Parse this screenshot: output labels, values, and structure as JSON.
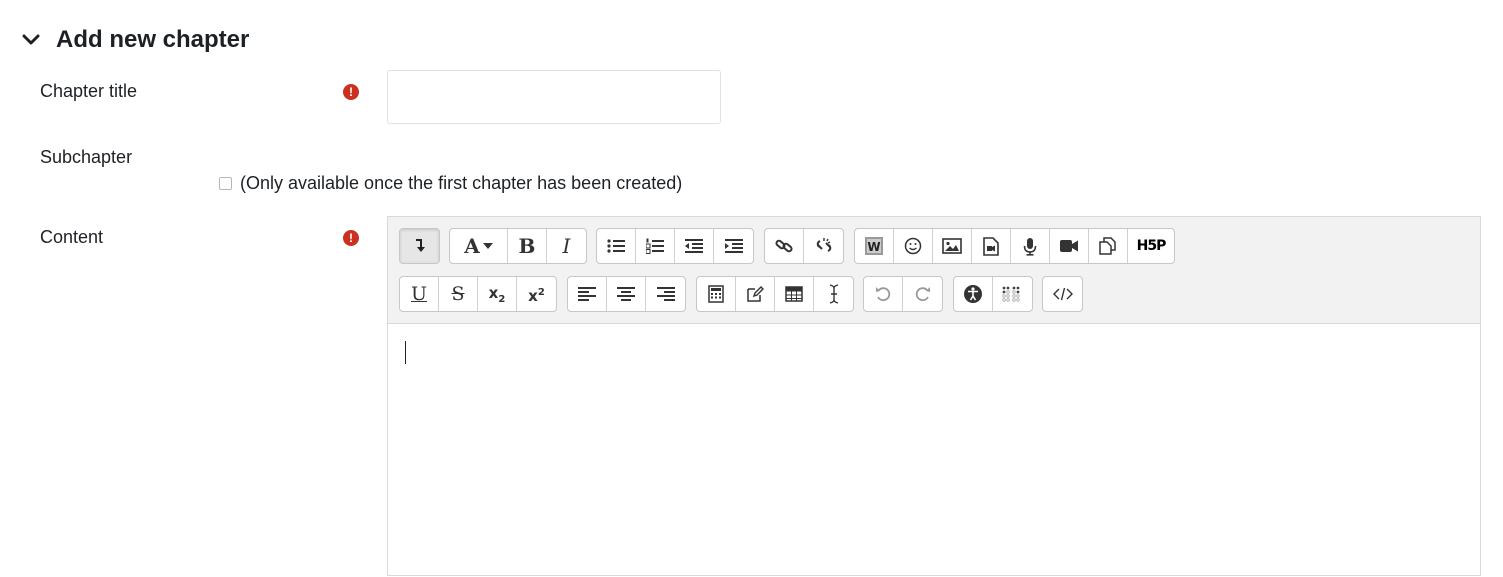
{
  "section": {
    "title": "Add new chapter"
  },
  "fields": {
    "chapter_title": {
      "label": "Chapter title",
      "value": ""
    },
    "subchapter": {
      "label": "Subchapter",
      "note": "(Only available once the first chapter has been created)"
    },
    "content": {
      "label": "Content"
    }
  },
  "colors": {
    "required": "#ca3120",
    "toolbar_bg": "#f2f2f2",
    "border": "#d9d9d9"
  },
  "toolbar": {
    "row1": [
      [
        "collapse-icon"
      ],
      [
        "font-style-icon",
        "bold-icon",
        "italic-icon"
      ],
      [
        "unordered-list-icon",
        "ordered-list-icon",
        "outdent-icon",
        "indent-icon"
      ],
      [
        "link-icon",
        "unlink-icon"
      ],
      [
        "word-paste-icon",
        "emoji-icon",
        "image-icon",
        "media-icon",
        "record-audio-icon",
        "record-video-icon",
        "manage-files-icon",
        "h5p-icon"
      ]
    ],
    "row2": [
      [
        "underline-icon",
        "strikethrough-icon",
        "subscript-icon",
        "superscript-icon"
      ],
      [
        "align-left-icon",
        "align-center-icon",
        "align-right-icon"
      ],
      [
        "calculator-icon",
        "edit-equation-icon",
        "table-icon",
        "cursor-icon"
      ],
      [
        "undo-icon",
        "redo-icon"
      ],
      [
        "accessibility-checker-icon",
        "braille-icon"
      ],
      [
        "html-source-icon"
      ]
    ],
    "glyphs": {
      "font": "A",
      "bold": "B",
      "italic": "I",
      "underline": "U",
      "strike": "S",
      "sub_base": "x",
      "sub_mark": "2",
      "sup_base": "x",
      "sup_mark": "2",
      "h5p": "H5P"
    }
  }
}
